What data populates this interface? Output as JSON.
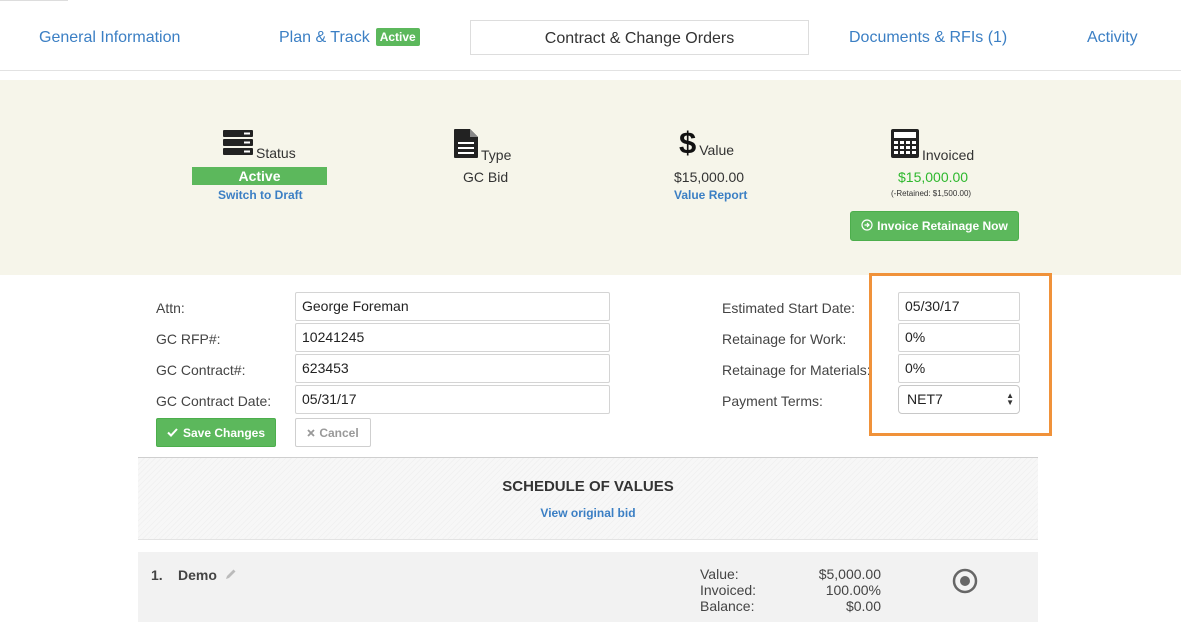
{
  "tabs": [
    {
      "label": "General Information"
    },
    {
      "label": "Plan & Track",
      "badge": "Active"
    },
    {
      "label": "Contract & Change Orders"
    },
    {
      "label": "Documents & RFIs (1)"
    },
    {
      "label": "Activity"
    }
  ],
  "summary": {
    "status": {
      "label": "Status",
      "value": "Active",
      "link": "Switch to Draft",
      "icon": "server-icon"
    },
    "type": {
      "label": "Type",
      "value": "GC Bid",
      "icon": "document-icon"
    },
    "value": {
      "label": "Value",
      "amount": "$15,000.00",
      "link": "Value Report",
      "icon": "dollar-icon"
    },
    "invoiced": {
      "label": "Invoiced",
      "amount": "$15,000.00",
      "retained": "(-Retained: $1,500.00)",
      "button": "Invoice Retainage Now",
      "icon": "calculator-icon"
    }
  },
  "form": {
    "attn": {
      "label": "Attn:",
      "value": "George Foreman"
    },
    "gc_rfp": {
      "label": "GC RFP#:",
      "value": "10241245"
    },
    "gc_contract": {
      "label": "GC Contract#:",
      "value": "623453"
    },
    "gc_contract_date": {
      "label": "GC Contract Date:",
      "value": "05/31/17"
    },
    "est_start": {
      "label": "Estimated Start Date:",
      "value": "05/30/17"
    },
    "ret_work": {
      "label": "Retainage for Work:",
      "value": "0%"
    },
    "ret_materials": {
      "label": "Retainage for Materials:",
      "value": "0%"
    },
    "payment_terms": {
      "label": "Payment Terms:",
      "value": "NET7"
    },
    "save_label": "Save Changes",
    "cancel_label": "Cancel"
  },
  "sov": {
    "title": "SCHEDULE OF VALUES",
    "link": "View original bid",
    "items": [
      {
        "number": "1.",
        "name": "Demo",
        "value_label": "Value:",
        "value": "$5,000.00",
        "invoiced_label": "Invoiced:",
        "invoiced": "100.00%",
        "balance_label": "Balance:",
        "balance": "$0.00"
      }
    ]
  },
  "colors": {
    "accent_blue": "#3b7fc4",
    "green": "#5cb85c",
    "highlight_orange": "#f0923a",
    "summary_bg": "#f6f5ea"
  }
}
